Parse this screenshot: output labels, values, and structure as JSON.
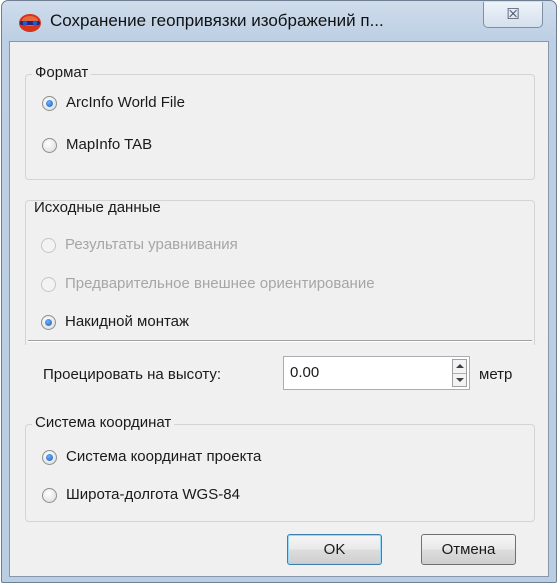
{
  "window": {
    "title": "Сохранение геопривязки изображений п...",
    "close_label": "☒"
  },
  "format_group": {
    "legend": "Формат",
    "options": [
      {
        "label": "ArcInfo World File",
        "checked": true,
        "enabled": true
      },
      {
        "label": "MapInfo TAB",
        "checked": false,
        "enabled": true
      }
    ]
  },
  "source_group": {
    "legend": "Исходные данные",
    "options": [
      {
        "label": "Результаты уравнивания",
        "checked": false,
        "enabled": false
      },
      {
        "label": "Предварительное внешнее ориентирование",
        "checked": false,
        "enabled": false
      },
      {
        "label": "Накидной монтаж",
        "checked": true,
        "enabled": true
      }
    ]
  },
  "projection": {
    "label": "Проецировать на высоту:",
    "value": "0.00",
    "unit": "метр"
  },
  "coord_group": {
    "legend": "Система координат",
    "options": [
      {
        "label": "Система координат проекта",
        "checked": true,
        "enabled": true
      },
      {
        "label": "Широта-долгота WGS-84",
        "checked": false,
        "enabled": true
      }
    ]
  },
  "buttons": {
    "ok": "OK",
    "cancel": "Отмена"
  },
  "colors": {
    "titlebar": "#bccfe4",
    "dialog_bg": "#f0f0f0",
    "disabled_text": "#a6a6a6",
    "radio_dot": "#1f5cb8"
  }
}
